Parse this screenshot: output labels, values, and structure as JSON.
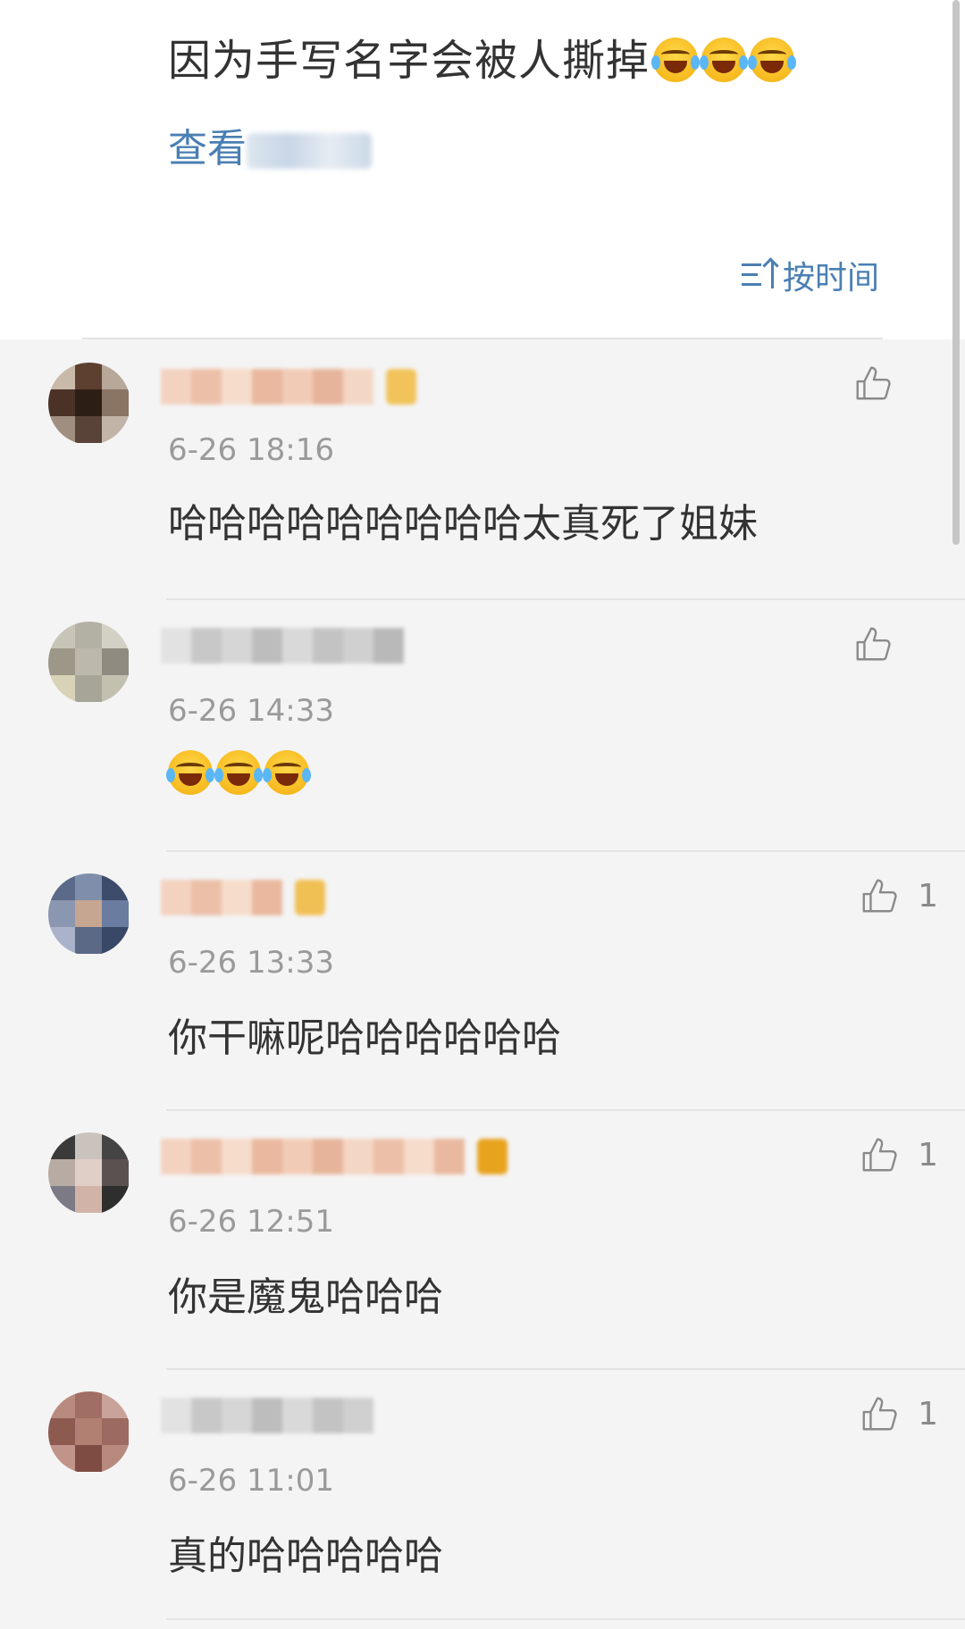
{
  "post": {
    "text": "因为手写名字会被人撕掉",
    "emoji_count": 3,
    "view_link_prefix": "查看"
  },
  "sort": {
    "label": "按时间",
    "icon": "sort-ascending-icon"
  },
  "comments": [
    {
      "time": "6-26 18:16",
      "text": "哈哈哈哈哈哈哈哈哈太真死了姐妹",
      "likes": "",
      "emoji_count": 0,
      "badge_color": "#f1c35a"
    },
    {
      "time": "6-26 14:33",
      "text": "",
      "likes": "",
      "emoji_count": 3,
      "badge_color": ""
    },
    {
      "time": "6-26 13:33",
      "text": "你干嘛呢哈哈哈哈哈哈",
      "likes": "1",
      "emoji_count": 0,
      "badge_color": "#f0c055"
    },
    {
      "time": "6-26 12:51",
      "text": "你是魔鬼哈哈哈",
      "likes": "1",
      "emoji_count": 0,
      "badge_color": "#e8a31e"
    },
    {
      "time": "6-26 11:01",
      "text": "真的哈哈哈哈哈",
      "likes": "1",
      "emoji_count": 0,
      "badge_color": ""
    }
  ],
  "colors": {
    "link": "#4a7fb3",
    "time": "#9a9a9a",
    "background": "#f4f4f4"
  }
}
